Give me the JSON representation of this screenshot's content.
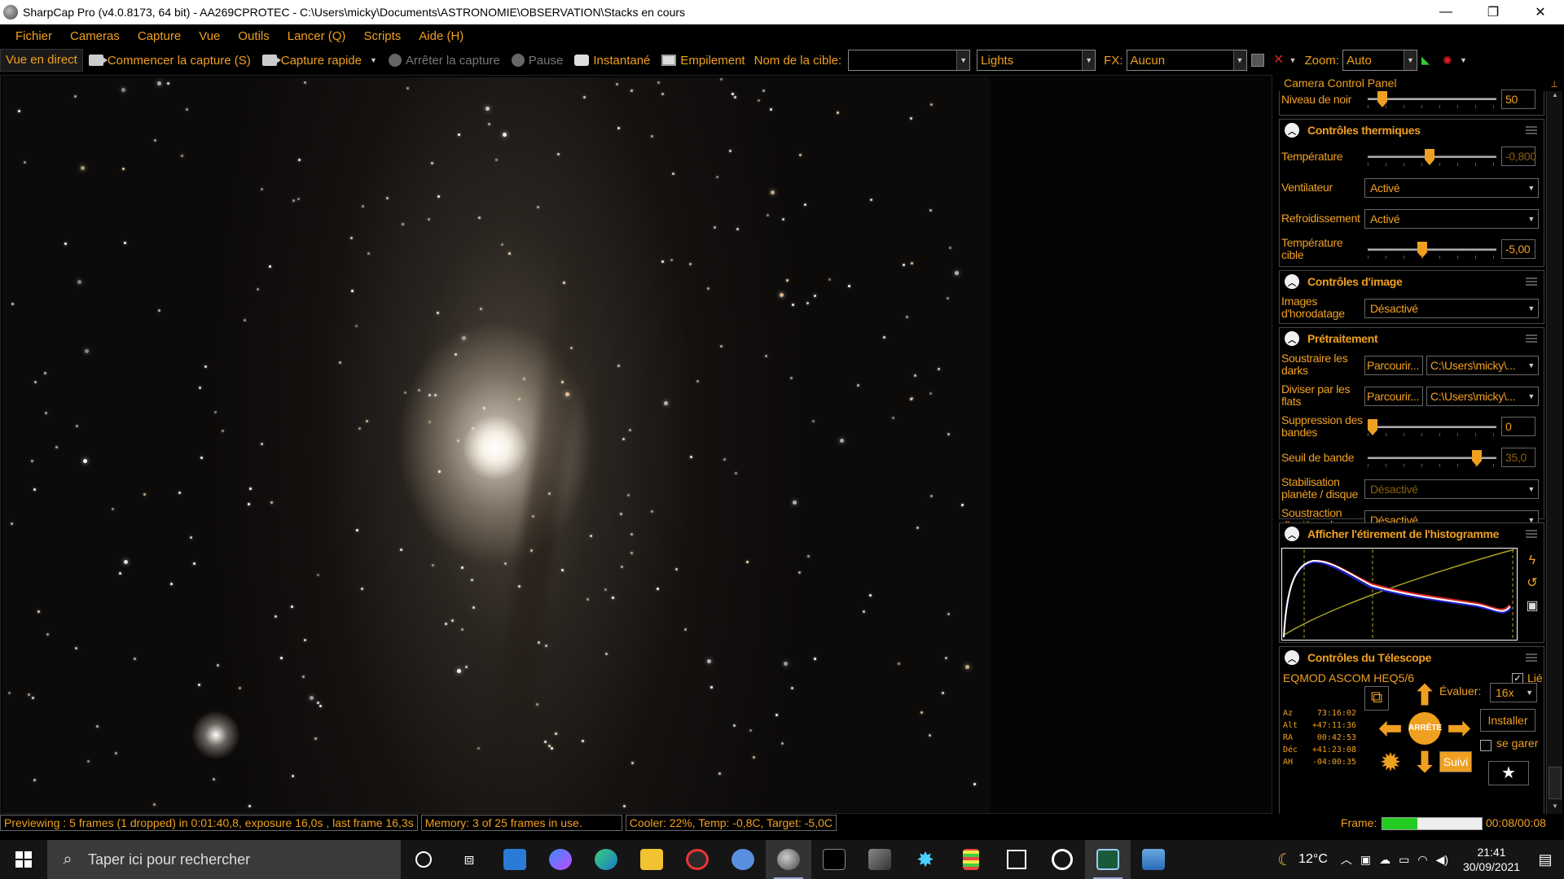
{
  "window": {
    "title": "SharpCap Pro (v4.0.8173, 64 bit) - AA269CPROTEC - C:\\Users\\micky\\Documents\\ASTRONOMIE\\OBSERVATION\\Stacks en cours",
    "minimize": "—",
    "maximize": "❐",
    "close": "✕"
  },
  "menu": [
    "Fichier",
    "Cameras",
    "Capture",
    "Vue",
    "Outils",
    "Lancer (Q)",
    "Scripts",
    "Aide (H)"
  ],
  "toolbar": {
    "live_view": "Vue en direct",
    "start_capture": "Commencer la capture (S)",
    "quick_capture": "Capture rapide",
    "stop_capture": "Arrêter la capture",
    "pause": "Pause",
    "snapshot": "Instantané",
    "stacking": "Empilement",
    "target_label": "Nom de la cible:",
    "target_value": "",
    "frame_type": "Lights",
    "fx_label": "FX:",
    "fx_value": "Aucun",
    "zoom_label": "Zoom:",
    "zoom_value": "Auto"
  },
  "panel": {
    "title": "Camera Control Panel",
    "black_level": {
      "label": "Niveau de noir",
      "value": "50",
      "level": 0.08
    },
    "thermal": {
      "header": "Contrôles thermiques",
      "temperature": {
        "label": "Température",
        "value": "-0,800",
        "level": 0.48
      },
      "fan": {
        "label": "Ventilateur",
        "value": "Activé"
      },
      "cooling": {
        "label": "Refroidissement",
        "value": "Activé"
      },
      "target_temp": {
        "label": "Température cible",
        "value": "-5,00",
        "level": 0.42
      }
    },
    "image": {
      "header": "Contrôles d'image",
      "timestamp": {
        "label": "Images d'horodatage",
        "value": "Désactivé"
      }
    },
    "preprocessing": {
      "header": "Prétraitement",
      "darks": {
        "label": "Soustraire les darks",
        "browse": "Parcourir...",
        "path": "C:\\Users\\micky\\..."
      },
      "flats": {
        "label": "Diviser par les flats",
        "browse": "Parcourir...",
        "path": "C:\\Users\\micky\\..."
      },
      "banding": {
        "label": "Suppression des bandes",
        "value": "0",
        "level": 0.0
      },
      "band_threshold": {
        "label": "Seuil de bande",
        "value": "35,0",
        "level": 0.88
      },
      "stabilization": {
        "label": "Stabilisation planète / disque",
        "value": "Désactivé"
      },
      "background": {
        "label": "Soustraction d'arrière-plan",
        "value": "Désactivé"
      }
    },
    "histogram": {
      "header": "Afficher l'étirement de l'histogramme"
    },
    "telescope": {
      "header": "Contrôles du Télescope",
      "mount": "EQMOD ASCOM HEQ5/6",
      "linked_label": "Lié",
      "rate_label": "Évaluer:",
      "rate_value": "16x",
      "install": "Installer",
      "park_label": "se garer",
      "stop": "ARRÊTE",
      "track": "Suivi",
      "coords": [
        {
          "k": "Az",
          "v": "73:16:02"
        },
        {
          "k": "Alt",
          "v": "+47:11:36"
        },
        {
          "k": "RA",
          "v": "00:42:53"
        },
        {
          "k": "Déc",
          "v": "+41:23:08"
        },
        {
          "k": "AH",
          "v": "-04:00:35"
        }
      ]
    }
  },
  "status": {
    "preview": "Previewing : 5 frames (1 dropped) in 0:01:40,8, exposure 16,0s , last frame 16,3s",
    "memory": "Memory: 3 of 25 frames in use.",
    "cooler": "Cooler: 22%, Temp: -0,8C, Target: -5,0C",
    "frame_label": "Frame:",
    "frame_progress": 0.35,
    "frame_time": "00:08/00:08"
  },
  "taskbar": {
    "search_placeholder": "Taper ici pour rechercher",
    "weather": "12°C",
    "time": "21:41",
    "date": "30/09/2021"
  }
}
